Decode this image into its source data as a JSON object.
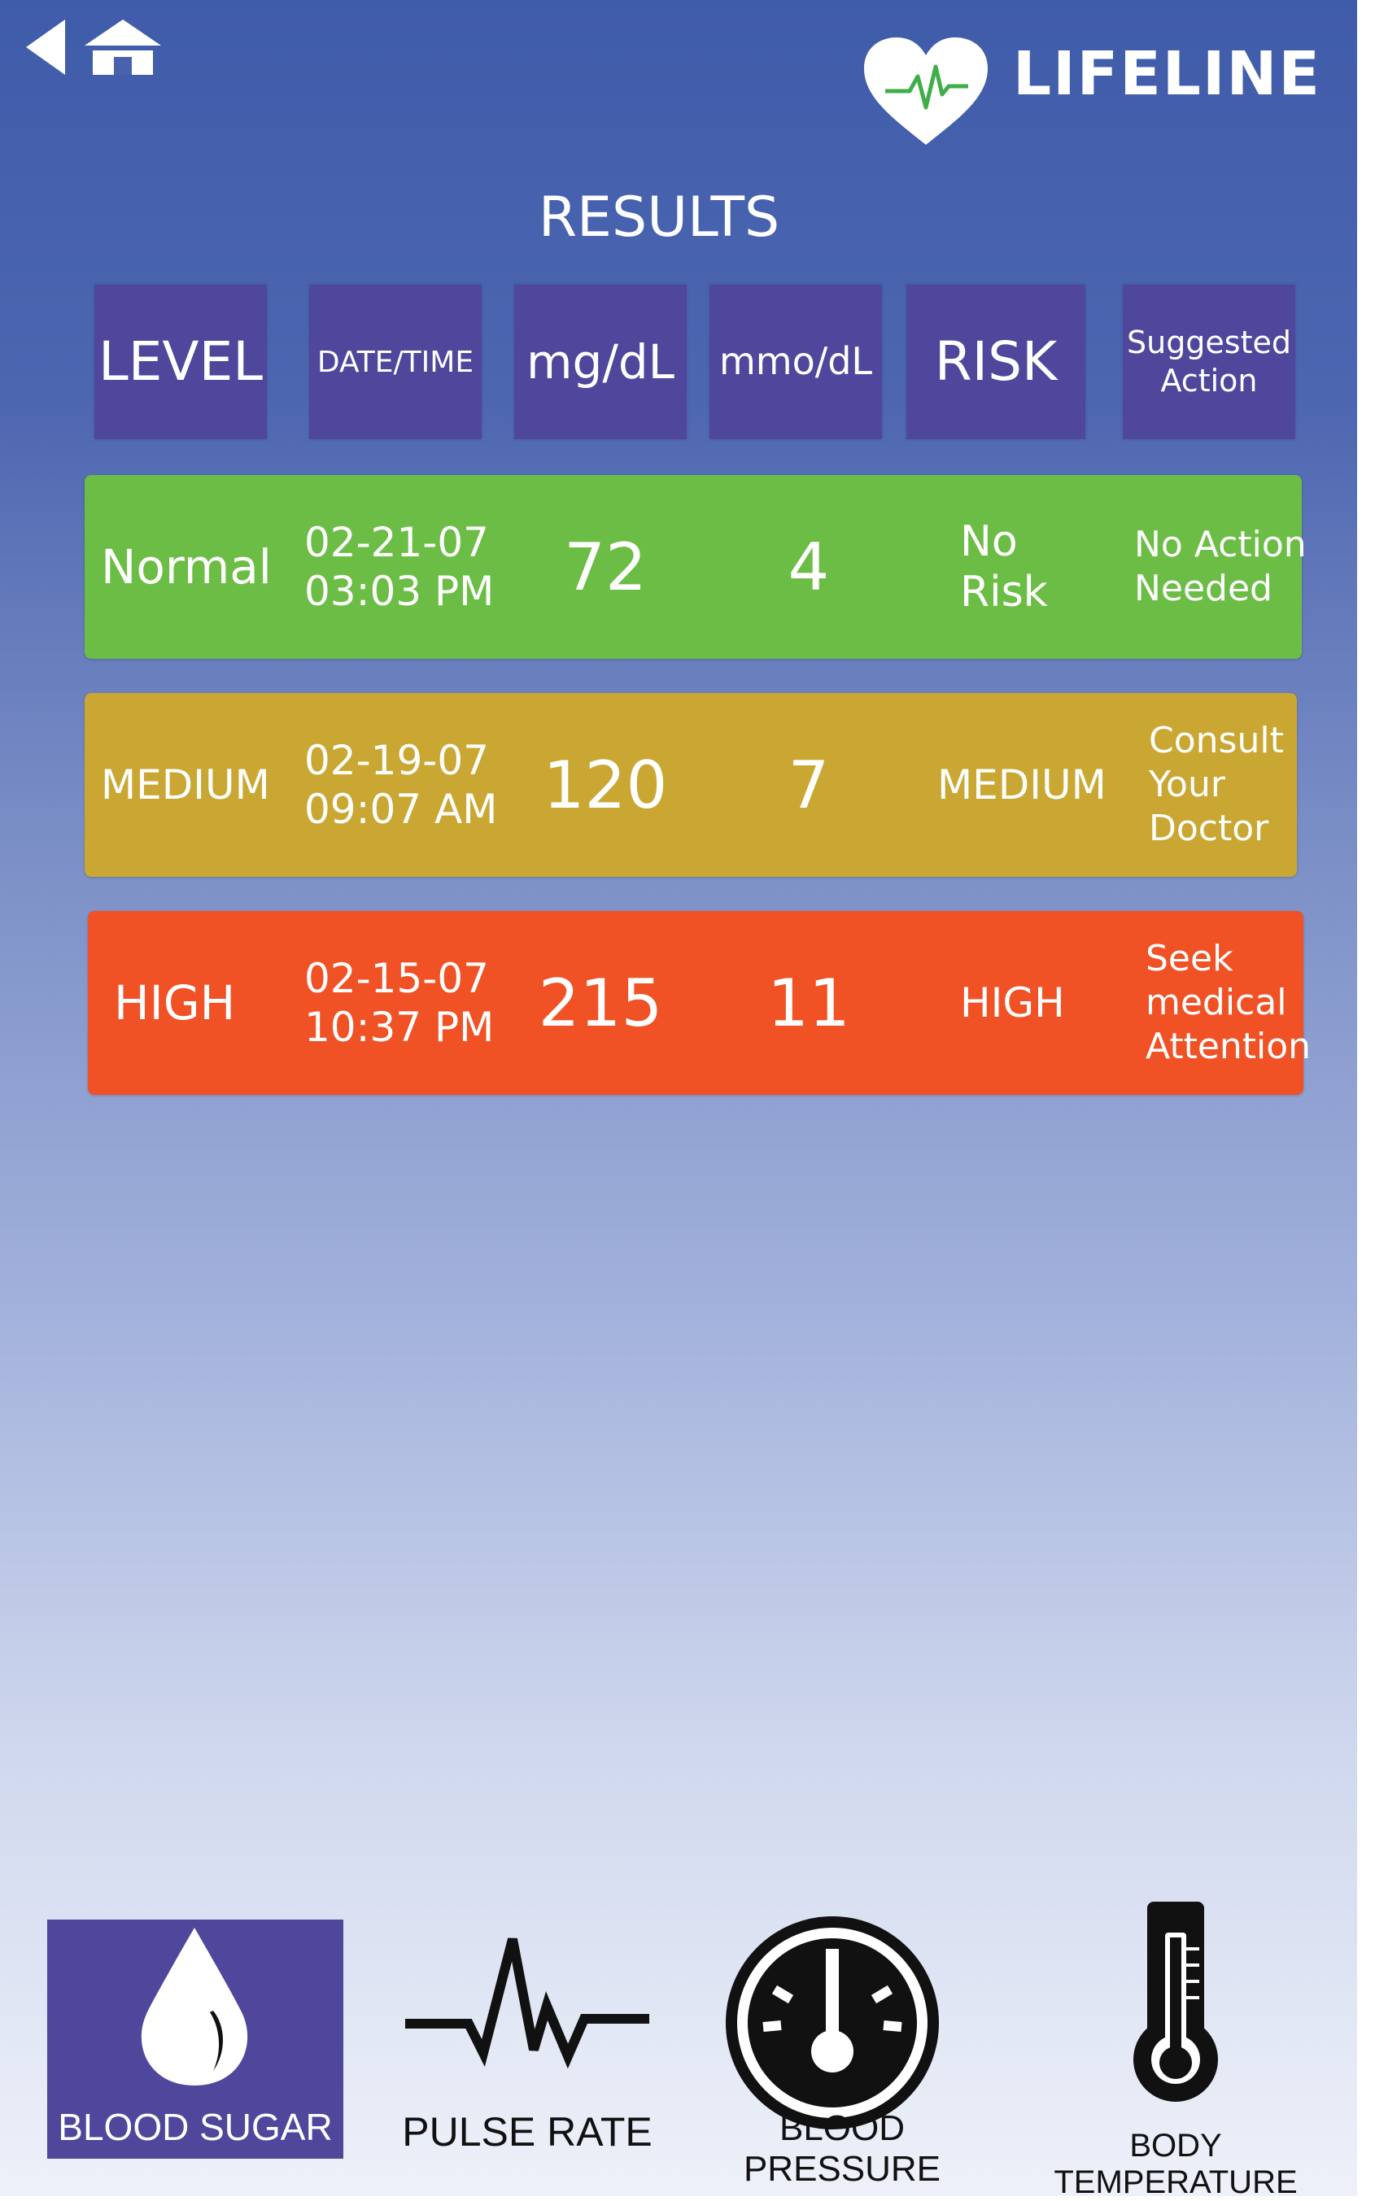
{
  "app": {
    "name": "LIFELINE"
  },
  "header": {
    "title": "RESULTS"
  },
  "columns": [
    {
      "label": "LEVEL"
    },
    {
      "label": "DATE/TIME"
    },
    {
      "label": "mg/dL"
    },
    {
      "label": "mmo/dL"
    },
    {
      "label": "RISK"
    },
    {
      "label": "Suggested Action"
    }
  ],
  "rows": [
    {
      "level": "Normal",
      "date": "02-21-07",
      "time": "03:03 PM",
      "mgdl": "72",
      "mmol": "4",
      "risk": "No Risk",
      "action": "No Action Needed",
      "color": "#6cbd45"
    },
    {
      "level": "MEDIUM",
      "date": "02-19-07",
      "time": "09:07 AM",
      "mgdl": "120",
      "mmol": "7",
      "risk": "MEDIUM",
      "action": "Consult Your Doctor",
      "color": "#c9a732"
    },
    {
      "level": "HIGH",
      "date": "02-15-07",
      "time": "10:37 PM",
      "mgdl": "215",
      "mmol": "11",
      "risk": "HIGH",
      "action": "Seek medical Attention",
      "color": "#f05226"
    }
  ],
  "nav": [
    {
      "label": "BLOOD SUGAR",
      "icon": "blood-drop-icon",
      "active": true
    },
    {
      "label": "PULSE RATE",
      "icon": "pulse-wave-icon",
      "active": false
    },
    {
      "label": "BLOOD PRESSURE",
      "icon": "gauge-icon",
      "active": false
    },
    {
      "label": "BODY TEMPERATURE",
      "icon": "thermometer-icon",
      "active": false
    }
  ],
  "colors": {
    "header_cell": "#4e479c",
    "accent_green": "#6cbd45",
    "background_top": "#3f5caa"
  }
}
